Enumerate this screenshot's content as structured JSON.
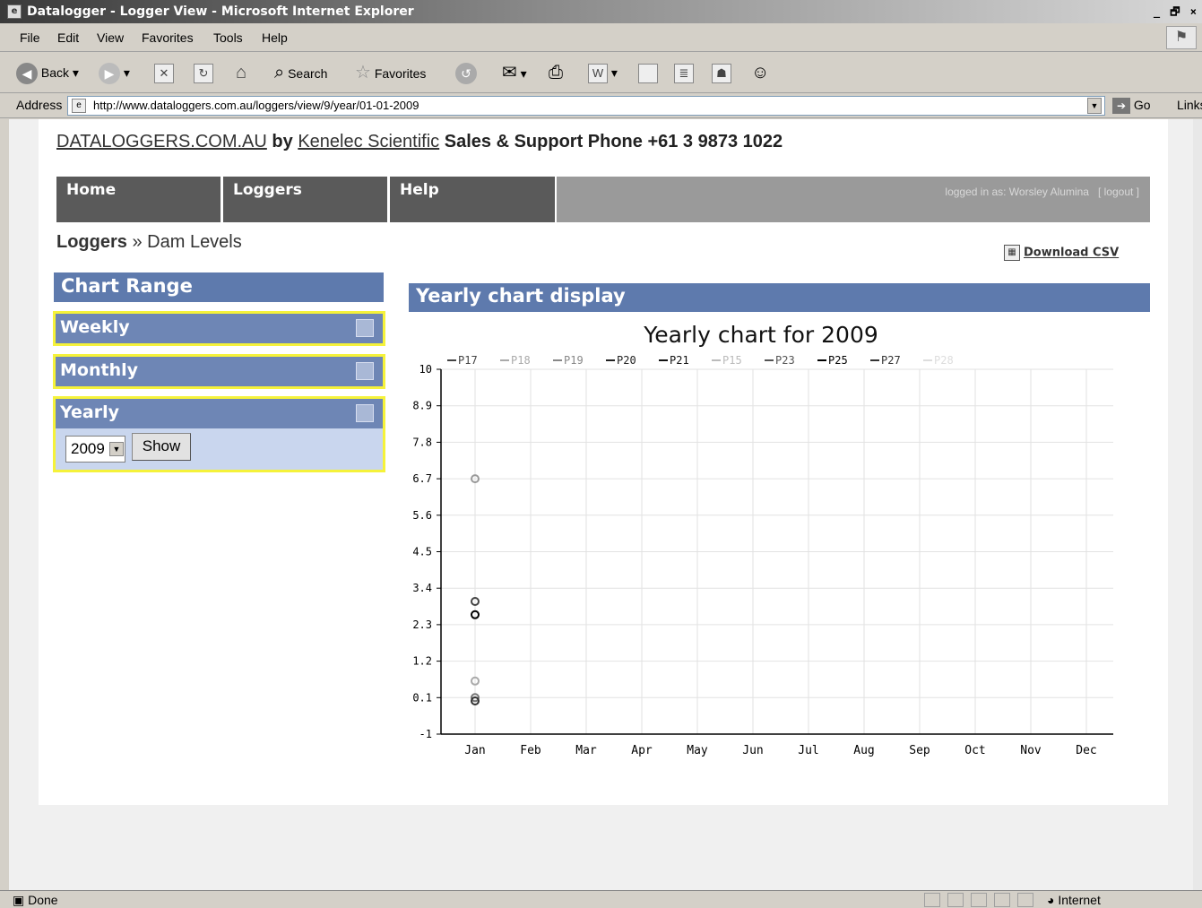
{
  "window": {
    "title": "Datalogger - Logger View - Microsoft Internet Explorer",
    "controls": "_ 🗗 ×"
  },
  "menu": {
    "items": [
      "File",
      "Edit",
      "View",
      "Favorites",
      "Tools",
      "Help"
    ]
  },
  "toolbar": {
    "back_label": "Back",
    "search_label": "Search",
    "favorites_label": "Favorites"
  },
  "address": {
    "label": "Address",
    "url": "http://www.dataloggers.com.au/loggers/view/9/year/01-01-2009",
    "go_label": "Go",
    "links_label": "Links"
  },
  "header": {
    "site": "DATALOGGERS.COM.AU",
    "by": "by",
    "company": "Kenelec Scientific",
    "phone_text": "Sales & Support Phone  +61 3 9873 1022"
  },
  "nav": {
    "tabs": [
      "Home",
      "Loggers",
      "Help"
    ],
    "logged_in": "logged in as: Worsley Alumina",
    "logout": "[ logout ]"
  },
  "breadcrumb": {
    "root": "Loggers",
    "sep": "»",
    "current": "Dam Levels"
  },
  "download_label": "Download CSV",
  "chart_range": {
    "title": "Chart Range",
    "panels": [
      "Weekly",
      "Monthly",
      "Yearly"
    ],
    "year_value": "2009",
    "show_label": "Show"
  },
  "chart_panel_title": "Yearly chart display",
  "chart_data": {
    "type": "scatter",
    "title": "Yearly chart for 2009",
    "categories": [
      "Jan",
      "Feb",
      "Mar",
      "Apr",
      "May",
      "Jun",
      "Jul",
      "Aug",
      "Sep",
      "Oct",
      "Nov",
      "Dec"
    ],
    "yticks": [
      "10",
      "8.9",
      "7.8",
      "6.7",
      "5.6",
      "4.5",
      "3.4",
      "2.3",
      "1.2",
      "0.1",
      "-1"
    ],
    "ylim": [
      -1,
      10
    ],
    "legend_position": "top",
    "grid": true,
    "series": [
      {
        "name": "P17",
        "color": "#444444",
        "points": []
      },
      {
        "name": "P18",
        "color": "#aaaaaa",
        "points": []
      },
      {
        "name": "P19",
        "color": "#888888",
        "points": []
      },
      {
        "name": "P20",
        "color": "#222222",
        "points": []
      },
      {
        "name": "P21",
        "color": "#111111",
        "points": []
      },
      {
        "name": "P15",
        "color": "#bbbbbb",
        "points": []
      },
      {
        "name": "P23",
        "color": "#555555",
        "points": []
      },
      {
        "name": "P25",
        "color": "#000000",
        "points": []
      },
      {
        "name": "P27",
        "color": "#333333",
        "points": []
      },
      {
        "name": "P28",
        "color": "#dddddd",
        "points": []
      }
    ],
    "points": [
      {
        "x": "Jan",
        "y": 6.7,
        "color": "#999999"
      },
      {
        "x": "Jan",
        "y": 3.0,
        "color": "#444444"
      },
      {
        "x": "Jan",
        "y": 2.6,
        "color": "#000000"
      },
      {
        "x": "Jan",
        "y": 0.6,
        "color": "#aaaaaa"
      },
      {
        "x": "Jan",
        "y": 0.1,
        "color": "#777777"
      },
      {
        "x": "Jan",
        "y": 0.0,
        "color": "#333333"
      }
    ]
  },
  "status": {
    "left": "Done",
    "zone": "Internet"
  }
}
